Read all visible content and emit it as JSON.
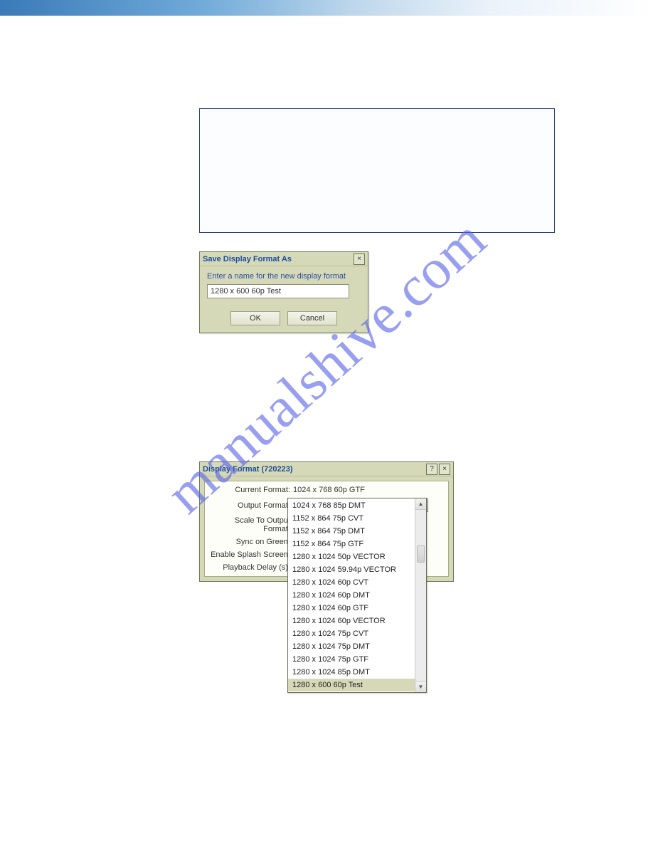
{
  "watermark": "manualshive.com",
  "saveDialog": {
    "title": "Save Display Format As",
    "prompt": "Enter a name for the new display format",
    "value": "1280 x 600 60p Test",
    "okLabel": "OK",
    "cancelLabel": "Cancel",
    "closeLabel": "×"
  },
  "displayDialog": {
    "title": "Display Format (720223)",
    "helpLabel": "?",
    "closeLabel": "×",
    "rows": {
      "currentFormat": {
        "label": "Current Format:",
        "value": "1024 x 768 60p GTF"
      },
      "outputFormat": {
        "label": "Output Format:",
        "value": "1280 x 600 60p Test"
      },
      "scaleToOutput": {
        "label": "Scale To Output Format:"
      },
      "syncOnGreen": {
        "label": "Sync on Green:"
      },
      "enableSplash": {
        "label": "Enable Splash Screen:"
      },
      "playbackDelay": {
        "label": "Playback Delay (s):"
      }
    },
    "dropdown": {
      "items": [
        "1024 x 768 85p DMT",
        "1152 x 864 75p CVT",
        "1152 x 864 75p DMT",
        "1152 x 864 75p GTF",
        "1280 x 1024 50p VECTOR",
        "1280 x 1024 59.94p VECTOR",
        "1280 x 1024 60p CVT",
        "1280 x 1024 60p DMT",
        "1280 x 1024 60p GTF",
        "1280 x 1024 60p VECTOR",
        "1280 x 1024 75p CVT",
        "1280 x 1024 75p DMT",
        "1280 x 1024 75p GTF",
        "1280 x 1024 85p DMT",
        "1280 x 600 60p Test"
      ],
      "selectedIndex": 14
    }
  }
}
